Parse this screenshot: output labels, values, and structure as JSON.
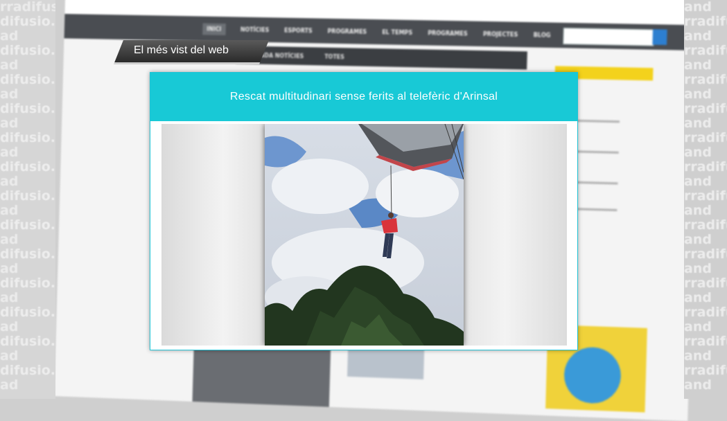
{
  "banner": {
    "text": "El més vist del web"
  },
  "popup": {
    "title": "Rescat multitudinari sense ferits al telefèric d'Arinsal"
  },
  "background_site": {
    "nav": [
      "INICI",
      "NOTÍCIES",
      "ESPORTS",
      "PROGRAMES",
      "EL TEMPS",
      "PROGRAMES",
      "PROJECTES",
      "BLOG"
    ],
    "subnav": [
      "PORTADA NOTÍCIES",
      "TOTES"
    ]
  },
  "watermark": {
    "left": [
      "rradifusio.ad",
      "difusio.ad",
      "ad",
      "difusio.ad",
      "ad",
      "difusio.ad",
      "ad",
      "difusio.ad",
      "ad",
      "difusio.ad",
      "ad",
      "difusio.ad",
      "ad",
      "difusio.ad",
      "ad",
      "difusio.ad",
      "ad",
      "difusio.ad",
      "ad",
      "difusio.ad",
      "ad",
      "difusio.ad",
      "ad",
      "difusio.ad",
      "ad",
      "difusio.ad",
      "ad"
    ],
    "right": [
      "and",
      "rradifu",
      "and",
      "rradifu",
      "and",
      "rradifu",
      "and",
      "rradifu",
      "and",
      "rradifu",
      "and",
      "rradifu",
      "and",
      "rradifu",
      "and",
      "rradifu",
      "and",
      "rradifu",
      "and",
      "rradifu",
      "and",
      "rradifu",
      "and",
      "rradifu",
      "and",
      "rradifu",
      "and"
    ]
  },
  "colors": {
    "header": "#18c9d6",
    "banner": "#3a3a3a",
    "nav": "#4a4d52",
    "search_button": "#2d7fd0"
  }
}
